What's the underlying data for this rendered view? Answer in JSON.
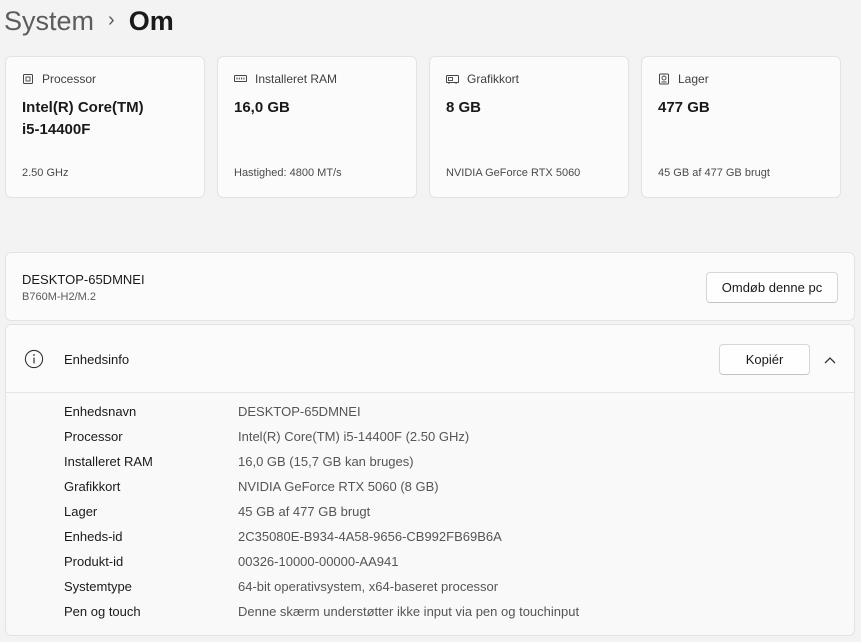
{
  "breadcrumb": {
    "parent": "System",
    "separator": "›",
    "current": "Om"
  },
  "spec_cards": [
    {
      "label": "Processor",
      "icon": "processor-icon",
      "value": "Intel(R) Core(TM) i5-14400F",
      "sub": "2.50 GHz"
    },
    {
      "label": "Installeret RAM",
      "icon": "ram-icon",
      "value": "16,0 GB",
      "sub": "Hastighed: 4800 MT/s"
    },
    {
      "label": "Grafikkort",
      "icon": "graphics-card-icon",
      "value": "8 GB",
      "sub": "NVIDIA GeForce RTX 5060"
    },
    {
      "label": "Lager",
      "icon": "storage-icon",
      "value": "477 GB",
      "sub": "45 GB af 477 GB brugt"
    }
  ],
  "pc": {
    "name": "DESKTOP-65DMNEI",
    "model": "B760M-H2/M.2",
    "rename_label": "Omdøb denne pc"
  },
  "device_info": {
    "title": "Enhedsinfo",
    "copy_label": "Kopiér",
    "rows": [
      {
        "label": "Enhedsnavn",
        "value": "DESKTOP-65DMNEI"
      },
      {
        "label": "Processor",
        "value": "Intel(R) Core(TM) i5-14400F (2.50 GHz)"
      },
      {
        "label": "Installeret RAM",
        "value": "16,0 GB (15,7 GB kan bruges)"
      },
      {
        "label": "Grafikkort",
        "value": "NVIDIA GeForce RTX 5060 (8 GB)"
      },
      {
        "label": "Lager",
        "value": "45 GB af 477 GB brugt"
      },
      {
        "label": "Enheds-id",
        "value": "2C35080E-B934-4A58-9656-CB992FB69B6A"
      },
      {
        "label": "Produkt-id",
        "value": "00326-10000-00000-AA941"
      },
      {
        "label": "Systemtype",
        "value": "64-bit operativsystem, x64-baseret processor"
      },
      {
        "label": "Pen og touch",
        "value": "Denne skærm understøtter ikke input via pen og touchinput"
      }
    ]
  }
}
